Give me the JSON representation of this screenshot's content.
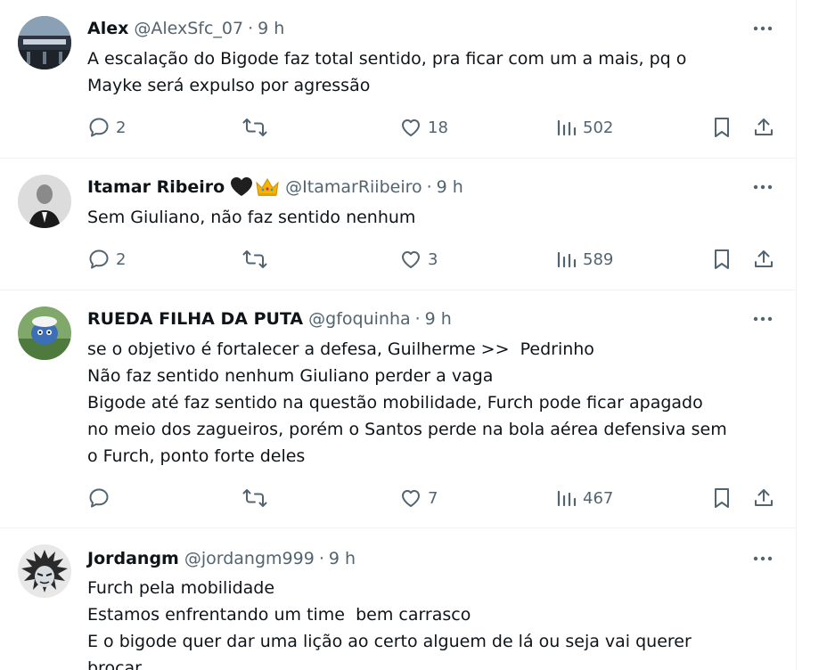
{
  "tweets": [
    {
      "name": "Alex",
      "handle": "@AlexSfc_07",
      "time": "9 h",
      "lines": [
        "A escalação do Bigode faz total sentido, pra ficar com um a mais, pq o",
        "Mayke será expulso por agressão"
      ],
      "replies": "2",
      "retweets": "",
      "likes": "18",
      "views": "502"
    },
    {
      "name": "Itamar Ribeiro",
      "handle": "@ItamarRiibeiro",
      "time": "9 h",
      "lines": [
        "Sem Giuliano, não faz sentido nenhum"
      ],
      "replies": "2",
      "retweets": "",
      "likes": "3",
      "views": "589"
    },
    {
      "name": "RUEDA FILHA DA PUTA",
      "handle": "@gfoquinha",
      "time": "9 h",
      "lines": [
        "se o objetivo é fortalecer a defesa, Guilherme >>  Pedrinho",
        "Não faz sentido nenhum Giuliano perder a vaga",
        "Bigode até faz sentido na questão mobilidade, Furch pode ficar apagado",
        "no meio dos zagueiros, porém o Santos perde na bola aérea defensiva sem",
        "o Furch, ponto forte deles"
      ],
      "replies": "",
      "retweets": "",
      "likes": "7",
      "views": "467"
    },
    {
      "name": "Jordangm",
      "handle": "@jordangm999",
      "time": "9 h",
      "lines": [
        "Furch pela mobilidade",
        "Estamos enfrentando um time  bem carrasco",
        "E o bigode quer dar uma lição ao certo alguem de lá ou seja vai querer",
        "brocar"
      ],
      "replies": "",
      "retweets": "",
      "likes": "",
      "views": ""
    }
  ],
  "colors": {
    "icon": "#536471",
    "text": "#0f1419",
    "divider": "#eff3f4"
  }
}
